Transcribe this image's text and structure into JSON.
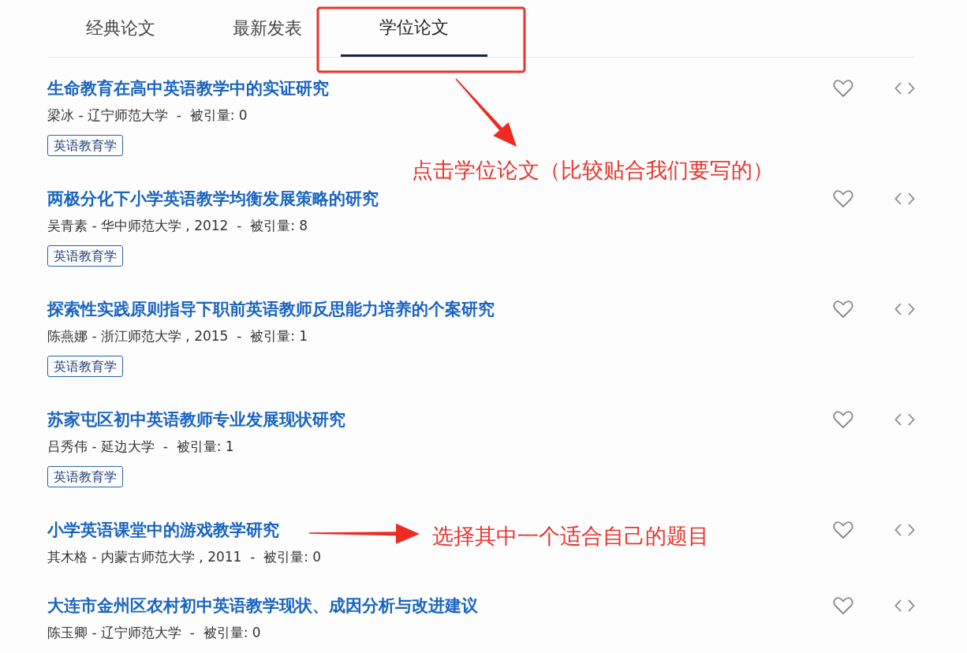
{
  "tabs": [
    {
      "label": "经典论文",
      "selected": false
    },
    {
      "label": "最新发表",
      "selected": false
    },
    {
      "label": "学位论文",
      "selected": true
    }
  ],
  "papers": [
    {
      "title": "生命教育在高中英语教学中的实证研究",
      "meta": "梁冰 - 辽宁师范大学  -  被引量: 0",
      "tags": [
        "英语教育学"
      ]
    },
    {
      "title": "两极分化下小学英语教学均衡发展策略的研究",
      "meta": "吴青素 - 华中师范大学 , 2012  -  被引量: 8",
      "tags": [
        "英语教育学"
      ]
    },
    {
      "title": "探索性实践原则指导下职前英语教师反思能力培养的个案研究",
      "meta": "陈燕娜 - 浙江师范大学 , 2015  -  被引量: 1",
      "tags": [
        "英语教育学"
      ]
    },
    {
      "title": "苏家屯区初中英语教师专业发展现状研究",
      "meta": "吕秀伟 - 延边大学  -  被引量: 1",
      "tags": [
        "英语教育学"
      ]
    },
    {
      "title": "小学英语课堂中的游戏教学研究",
      "meta": "其木格 - 内蒙古师范大学 , 2011  -  被引量: 0"
    },
    {
      "title": "大连市金州区农村初中英语教学现状、成因分析与改进建议",
      "meta": "陈玉卿 - 辽宁师范大学  -  被引量: 0"
    }
  ],
  "annotations": [
    {
      "text": "点击学位论文（比较贴合我们要写的）"
    },
    {
      "text": "选择其中一个适合自己的题目"
    }
  ]
}
